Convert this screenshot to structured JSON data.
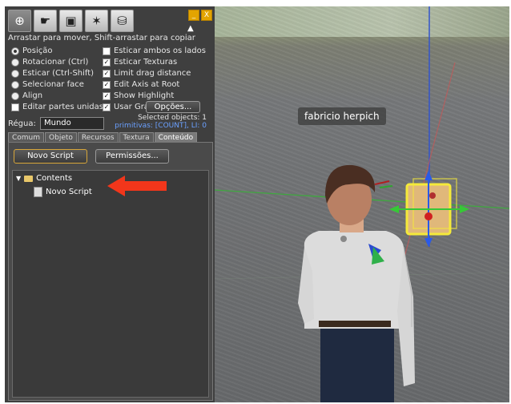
{
  "toolbar": {
    "tools": [
      {
        "icon": "magnify-icon",
        "glyph": "⊕"
      },
      {
        "icon": "grab-hand-icon",
        "glyph": "☛"
      },
      {
        "icon": "create-cube-icon",
        "glyph": "▣"
      },
      {
        "icon": "magic-wand-icon",
        "glyph": "✶"
      },
      {
        "icon": "land-icon",
        "glyph": "⛁"
      }
    ],
    "minimize": "_",
    "close": "X",
    "collapse": "▲"
  },
  "hint": "Arrastar para mover, Shift-arrastar para copiar",
  "modes": [
    {
      "label": "Posição",
      "selected": true
    },
    {
      "label": "Rotacionar (Ctrl)",
      "selected": false
    },
    {
      "label": "Esticar (Ctrl-Shift)",
      "selected": false
    },
    {
      "label": "Selecionar face",
      "selected": false
    },
    {
      "label": "Align",
      "selected": false
    }
  ],
  "edit_linked": "Editar partes unidas",
  "checks": [
    {
      "label": "Esticar ambos os lados",
      "checked": false
    },
    {
      "label": "Esticar Texturas",
      "checked": true
    },
    {
      "label": "Limit drag distance",
      "checked": true
    },
    {
      "label": "Edit Axis at Root",
      "checked": true
    },
    {
      "label": "Show Highlight",
      "checked": true
    },
    {
      "label": "Usar Gra",
      "checked": true
    }
  ],
  "options_button": "Opções...",
  "ruler_label": "Régua:",
  "ruler_value": "Mundo",
  "selected_objects": "Selected objects: 1",
  "primitives": "primitivas: [COUNT], LI: 0",
  "tabs": [
    "Comum",
    "Objeto",
    "Recursos",
    "Textura",
    "Conteúdo"
  ],
  "new_script_button": "Novo Script",
  "permissions_button": "Permissões...",
  "tree": {
    "folder": "Contents",
    "item": "Novo Script"
  },
  "scene": {
    "avatar_name": "fabricio herpich"
  }
}
